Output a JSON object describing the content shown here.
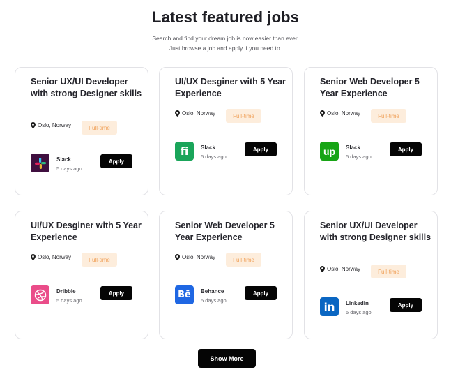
{
  "header": {
    "title": "Latest featured jobs",
    "subtitle_line1": "Search and find your dream job is now easier than ever.",
    "subtitle_line2": "Just browse a job and apply if you need to."
  },
  "jobs": [
    {
      "title": "Senior UX/UI Developer with strong Designer skills",
      "location": "Oslo, Norway",
      "type": "Full-time",
      "company": "Slack",
      "posted": "5 days ago",
      "logo_icon": "slack-logo-icon",
      "apply_label": "Apply"
    },
    {
      "title": "UI/UX Desginer with 5 Year Experience",
      "location": "Oslo, Norway",
      "type": "Full-time",
      "company": "Slack",
      "posted": "5 days ago",
      "logo_icon": "fi-logo-icon",
      "logo_text": "fi",
      "apply_label": "Apply"
    },
    {
      "title": "Senior Web Developer 5 Year Experience",
      "location": "Oslo, Norway",
      "type": "Full-time",
      "company": "Slack",
      "posted": "5 days ago",
      "logo_icon": "upwork-logo-icon",
      "logo_text": "up",
      "apply_label": "Apply"
    },
    {
      "title": "UI/UX Desginer with 5 Year Experience",
      "location": "Oslo, Norway",
      "type": "Full-time",
      "company": "Dribble",
      "posted": "5 days ago",
      "logo_icon": "dribbble-logo-icon",
      "apply_label": "Apply"
    },
    {
      "title": "Senior Web Developer 5 Year Experience",
      "location": "Oslo, Norway",
      "type": "Full-time",
      "company": "Behance",
      "posted": "5 days ago",
      "logo_icon": "behance-logo-icon",
      "logo_text": "Bē",
      "apply_label": "Apply"
    },
    {
      "title": "Senior UX/UI Developer with strong Designer skills",
      "location": "Oslo, Norway",
      "type": "Full-time",
      "company": "Linkedin",
      "posted": "5 days ago",
      "logo_icon": "linkedin-logo-icon",
      "logo_text": "in",
      "apply_label": "Apply"
    }
  ],
  "colors": {
    "badge_bg": "#fdeddc",
    "badge_text": "#f0a15a",
    "button_bg": "#050505",
    "fi_green": "#1aa55a",
    "upwork_green": "#17a415",
    "dribbble_pink": "#ea4c89",
    "behance_blue": "#1f67e3",
    "linkedin_blue": "#0a66c2"
  },
  "footer": {
    "show_more_label": "Show More"
  }
}
